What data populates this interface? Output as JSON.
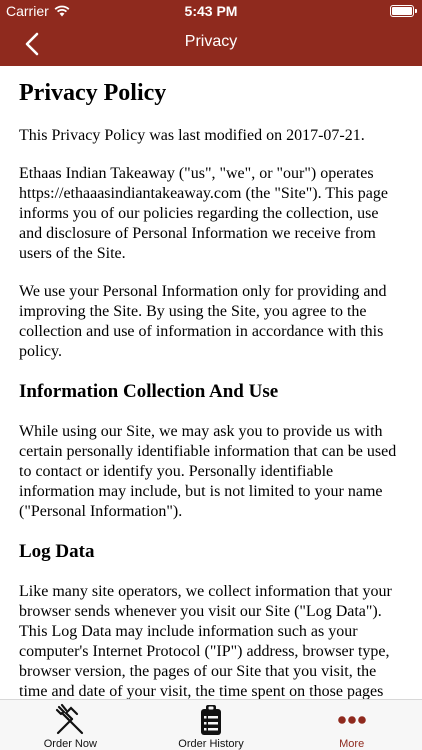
{
  "status_bar": {
    "carrier": "Carrier",
    "time": "5:43 PM"
  },
  "nav": {
    "title": "Privacy"
  },
  "policy": {
    "title": "Privacy Policy",
    "paragraphs_intro": [
      "This Privacy Policy was last modified on 2017-07-21.",
      "Ethaas Indian Takeaway (\"us\", \"we\", or \"our\") operates https://ethaaasindiantakeaway.com (the \"Site\"). This page informs you of our policies regarding the collection, use and disclosure of Personal Information we receive from users of the Site.",
      "We use your Personal Information only for providing and improving the Site. By using the Site, you agree to the collection and use of information in accordance with this policy."
    ],
    "section1": {
      "heading": "Information Collection And Use",
      "text": "While using our Site, we may ask you to provide us with certain personally identifiable information that can be used to contact or identify you. Personally identifiable information may include, but is not limited to your name (\"Personal Information\")."
    },
    "section2": {
      "heading": "Log Data",
      "text": "Like many site operators, we collect information that your browser sends whenever you visit our Site (\"Log Data\"). This Log Data may include information such as your computer's Internet Protocol (\"IP\") address, browser type, browser version, the pages of our Site that you visit, the time and date of your visit, the time spent on those pages and other statistics."
    }
  },
  "tabs": [
    {
      "label": "Order Now",
      "icon": "fork-knife-icon"
    },
    {
      "label": "Order History",
      "icon": "clipboard-list-icon"
    },
    {
      "label": "More",
      "icon": "more-dots-icon"
    }
  ],
  "colors": {
    "brand": "#8f2a1e",
    "tab_active": "#8f2a1e"
  }
}
